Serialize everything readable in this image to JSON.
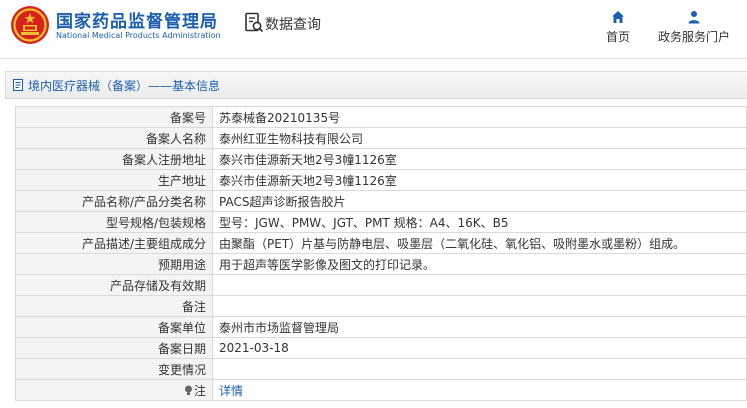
{
  "header": {
    "brand_cn": "国家药品监督管理局",
    "brand_en": "National Medical Products Administration",
    "query_label": "数据查询",
    "nav": [
      {
        "label": "首页",
        "icon": "home-icon"
      },
      {
        "label": "政务服务门户",
        "icon": "user-icon"
      }
    ]
  },
  "breadcrumb": {
    "text": "境内医疗器械（备案）——基本信息"
  },
  "rows": [
    {
      "label": "备案号",
      "value": "苏泰械备20210135号"
    },
    {
      "label": "备案人名称",
      "value": "泰州红亚生物科技有限公司"
    },
    {
      "label": "备案人注册地址",
      "value": "泰兴市佳源新天地2号3幢1126室"
    },
    {
      "label": "生产地址",
      "value": "泰兴市佳源新天地2号3幢1126室"
    },
    {
      "label": "产品名称/产品分类名称",
      "value": "PACS超声诊断报告胶片"
    },
    {
      "label": "型号规格/包装规格",
      "value": "型号：JGW、PMW、JGT、PMT 规格：A4、16K、B5"
    },
    {
      "label": "产品描述/主要组成成分",
      "value": "由聚酯（PET）片基与防静电层、吸墨层（二氧化硅、氧化铝、吸附墨水或墨粉）组成。"
    },
    {
      "label": "预期用途",
      "value": "用于超声等医学影像及图文的打印记录。"
    },
    {
      "label": "产品存储及有效期",
      "value": ""
    },
    {
      "label": "备注",
      "value": ""
    },
    {
      "label": "备案单位",
      "value": "泰州市市场监督管理局"
    },
    {
      "label": "备案日期",
      "value": "2021-03-18"
    },
    {
      "label": "变更情况",
      "value": ""
    },
    {
      "label": "注",
      "value": "详情"
    }
  ],
  "colors": {
    "brand_blue": "#1c5fb0",
    "emblem_red": "#d8231d",
    "emblem_gold": "#f2c230",
    "label_bg": "#f4f4f4",
    "border": "#d9d9d9"
  }
}
